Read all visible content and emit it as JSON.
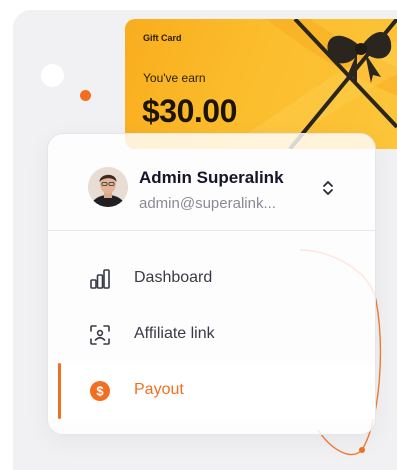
{
  "gift_card": {
    "label": "Gift Card",
    "earn_text": "You've earn",
    "amount": "$30.00",
    "ribbon_icon": "ribbon-bow-icon"
  },
  "account": {
    "name": "Admin Superalink",
    "email": "admin@superalink...",
    "avatar_icon": "user-avatar",
    "switcher_icon": "chevron-up-down-icon"
  },
  "nav": {
    "items": [
      {
        "label": "Dashboard",
        "icon": "bar-chart-icon",
        "active": false
      },
      {
        "label": "Affiliate link",
        "icon": "scan-link-icon",
        "active": false
      },
      {
        "label": "Payout",
        "icon": "dollar-circle-icon",
        "active": true
      }
    ]
  },
  "colors": {
    "accent": "#f26f21",
    "gift_card_start": "#f9ad1e",
    "gift_card_end": "#fcc53a",
    "text_dark": "#14142b",
    "text_muted": "#8a8a97",
    "panel_bg": "#f1f1f3"
  }
}
